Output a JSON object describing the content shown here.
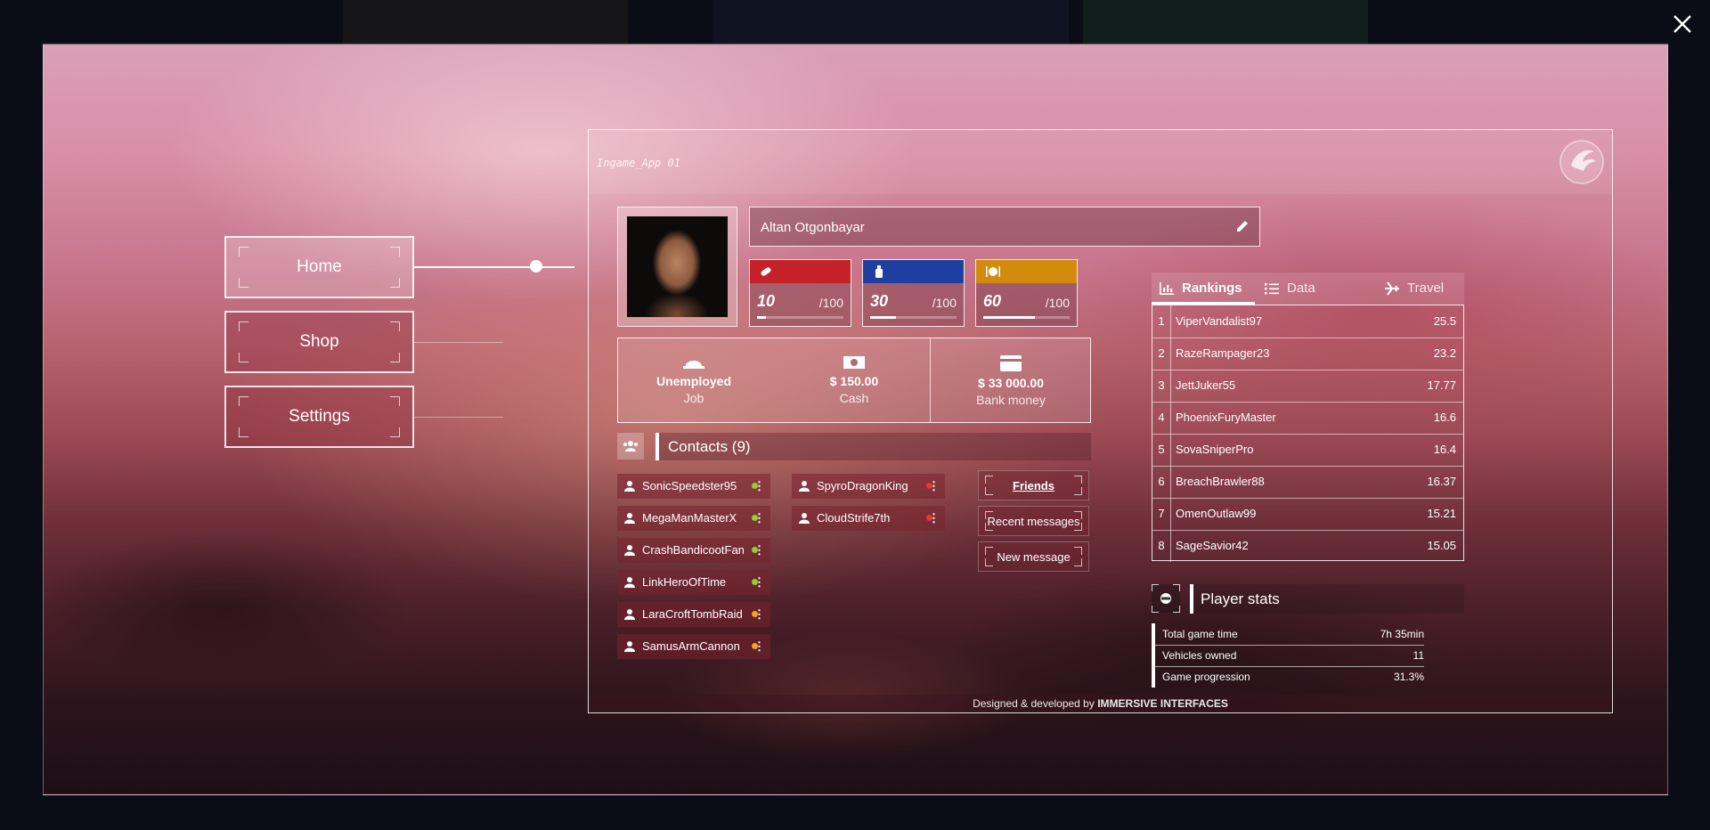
{
  "app": {
    "title": "Ingame_App 01",
    "footer_prefix": "Designed & developed by ",
    "footer_brand": "IMMERSIVE INTERFACES"
  },
  "nav": [
    {
      "label": "Home",
      "active": true
    },
    {
      "label": "Shop",
      "active": false
    },
    {
      "label": "Settings",
      "active": false
    }
  ],
  "profile": {
    "name": "Altan Otgonbayar",
    "stats": [
      {
        "icon": "bandage-icon",
        "color": "#c42128",
        "value": "10",
        "max": "/100",
        "fraction": 0.1
      },
      {
        "icon": "bottle-icon",
        "color": "#1f3fa0",
        "value": "30",
        "max": "/100",
        "fraction": 0.3
      },
      {
        "icon": "food-icon",
        "color": "#d18c0c",
        "value": "60",
        "max": "/100",
        "fraction": 0.6
      }
    ],
    "finance": {
      "job": {
        "value": "Unemployed",
        "label": "Job",
        "icon": "helmet-icon"
      },
      "cash": {
        "value": "$ 150.00",
        "label": "Cash",
        "icon": "cash-icon"
      },
      "bank": {
        "value": "$ 33 000.00",
        "label": "Bank money",
        "icon": "card-icon"
      }
    }
  },
  "contacts": {
    "title": "Contacts (9)",
    "items": [
      {
        "name": "SonicSpeedster95",
        "status": "#8fd12b"
      },
      {
        "name": "MegaManMasterX",
        "status": "#8fd12b"
      },
      {
        "name": "CrashBandicootFan",
        "status": "#8fd12b"
      },
      {
        "name": "LinkHeroOfTime",
        "status": "#8fd12b"
      },
      {
        "name": "LaraCroftTombRaid",
        "status": "#f1a51c"
      },
      {
        "name": "SamusArmCannon",
        "status": "#f1a51c"
      },
      {
        "name": "SpyroDragonKing",
        "status": "#e53935"
      },
      {
        "name": "CloudStrife7th",
        "status": "#e53935"
      }
    ],
    "buttons": {
      "friends": "Friends",
      "recent": "Recent messages",
      "new": "New message"
    }
  },
  "tabs": [
    {
      "label": "Rankings",
      "icon": "bar-chart-icon",
      "active": true
    },
    {
      "label": "Data",
      "icon": "list-icon",
      "active": false
    },
    {
      "label": "Travel",
      "icon": "airplane-icon",
      "active": false
    }
  ],
  "rankings": [
    {
      "rank": "1",
      "name": "ViperVandalist97",
      "score": "25.5"
    },
    {
      "rank": "2",
      "name": "RazeRampager23",
      "score": "23.2"
    },
    {
      "rank": "3",
      "name": "JettJuker55",
      "score": "17.77"
    },
    {
      "rank": "4",
      "name": "PhoenixFuryMaster",
      "score": "16.6"
    },
    {
      "rank": "5",
      "name": "SovaSniperPro",
      "score": "16.4"
    },
    {
      "rank": "6",
      "name": "BreachBrawler88",
      "score": "16.37"
    },
    {
      "rank": "7",
      "name": "OmenOutlaw99",
      "score": "15.21"
    },
    {
      "rank": "8",
      "name": "SageSavior42",
      "score": "15.05"
    }
  ],
  "player_stats": {
    "title": "Player stats",
    "rows": [
      {
        "label": "Total game time",
        "value": "7h 35min"
      },
      {
        "label": "Vehicles owned",
        "value": "11"
      },
      {
        "label": "Game progression",
        "value": "31.3%"
      }
    ]
  }
}
